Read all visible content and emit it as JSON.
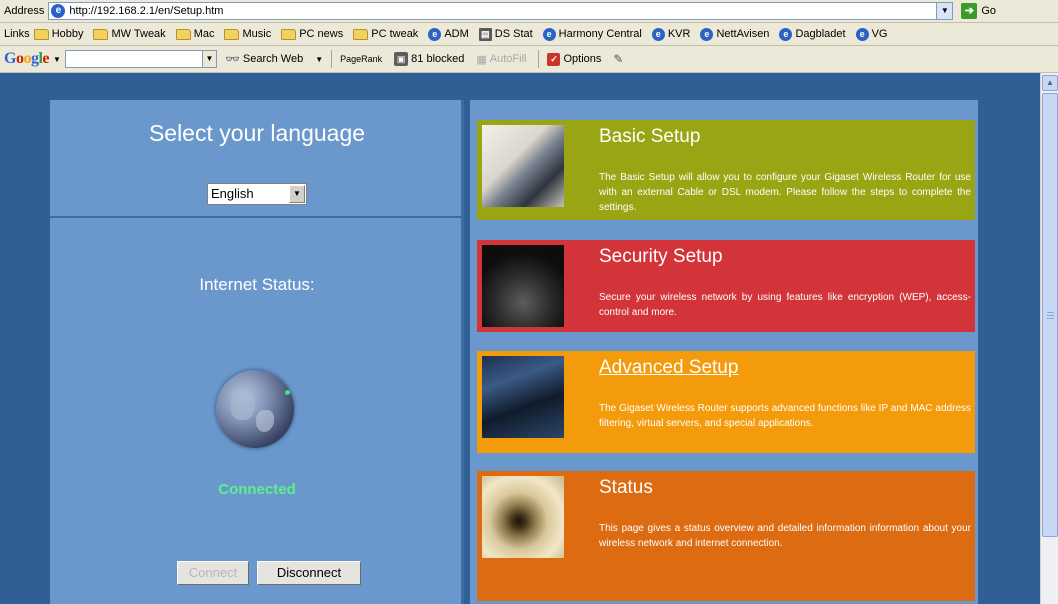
{
  "address_bar": {
    "label": "Address",
    "url": "http://192.168.2.1/en/Setup.htm",
    "go_label": "Go"
  },
  "links_bar": {
    "label": "Links",
    "items": [
      {
        "label": "Hobby",
        "icon": "folder-icon"
      },
      {
        "label": "MW Tweak",
        "icon": "folder-icon"
      },
      {
        "label": "Mac",
        "icon": "folder-icon"
      },
      {
        "label": "Music",
        "icon": "folder-icon"
      },
      {
        "label": "PC news",
        "icon": "folder-icon"
      },
      {
        "label": "PC tweak",
        "icon": "folder-icon"
      },
      {
        "label": "ADM",
        "icon": "ie-page-icon"
      },
      {
        "label": "DS Stat",
        "icon": "page-icon"
      },
      {
        "label": "Harmony Central",
        "icon": "ie-page-icon"
      },
      {
        "label": "KVR",
        "icon": "ie-page-icon"
      },
      {
        "label": "NettAvisen",
        "icon": "ie-page-icon"
      },
      {
        "label": "Dagbladet",
        "icon": "ie-page-icon"
      },
      {
        "label": "VG",
        "icon": "ie-page-icon"
      }
    ]
  },
  "google_toolbar": {
    "logo": "Google",
    "search_value": "",
    "search_web_label": "Search Web",
    "pagerank_label": "PageRank",
    "blocked_label": "81 blocked",
    "autofill_label": "AutoFill",
    "options_label": "Options"
  },
  "language_panel": {
    "title": "Select your language",
    "selected_language": "English"
  },
  "internet_status": {
    "label": "Internet Status:",
    "value": "Connected",
    "connect_label": "Connect",
    "disconnect_label": "Disconnect"
  },
  "setup_cards": [
    {
      "title": "Basic Setup",
      "description": "The Basic Setup will allow you to configure your Gigaset Wireless Router for use with an external Cable or DSL modem. Please follow the steps to complete the settings.",
      "color": "#9aa514"
    },
    {
      "title": "Security Setup",
      "description": "Secure your wireless network by using features like encryption (WEP), access-control and more.",
      "color": "#d2343a"
    },
    {
      "title": "Advanced Setup",
      "description": "The Gigaset Wireless Router supports advanced functions like IP and MAC address filtering, virtual servers, and special applications.",
      "color": "#f49b0c"
    },
    {
      "title": "Status",
      "description": "This page gives a status overview and detailed information information about your wireless network and internet connection.",
      "color": "#dd6b12"
    }
  ],
  "colors": {
    "page_background": "#2f5f95",
    "panel_background": "#6b98cc",
    "connected_text": "#5df08a"
  }
}
